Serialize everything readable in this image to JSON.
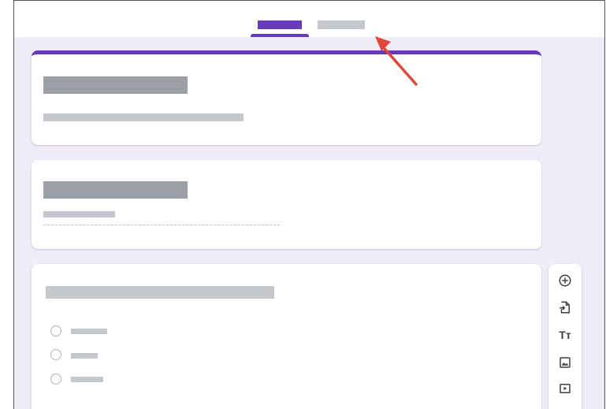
{
  "tabs": [
    {
      "id": "questions",
      "active": true,
      "color": "#673ab7"
    },
    {
      "id": "responses",
      "active": false,
      "color": "#c4c7cb"
    }
  ],
  "accent": "#673ab7",
  "background": "#f0ebf8",
  "annotation": {
    "color": "#e0483a",
    "icon": "red-arrow"
  },
  "title_card": {
    "placeholders": [
      "title-bar",
      "description-bar"
    ]
  },
  "question_cards": [
    {
      "placeholders": [
        "question-title-bar",
        "short-answer-bar"
      ],
      "input": "dashed-underline"
    },
    {
      "placeholders": [
        "question-title-bar"
      ],
      "options_count": 3
    }
  ],
  "toolbar": {
    "tools": [
      {
        "icon": "add-circle-icon"
      },
      {
        "icon": "import-question-icon"
      },
      {
        "icon": "title-text-icon",
        "glyph": "Tт"
      },
      {
        "icon": "image-icon"
      },
      {
        "icon": "video-icon"
      }
    ]
  }
}
